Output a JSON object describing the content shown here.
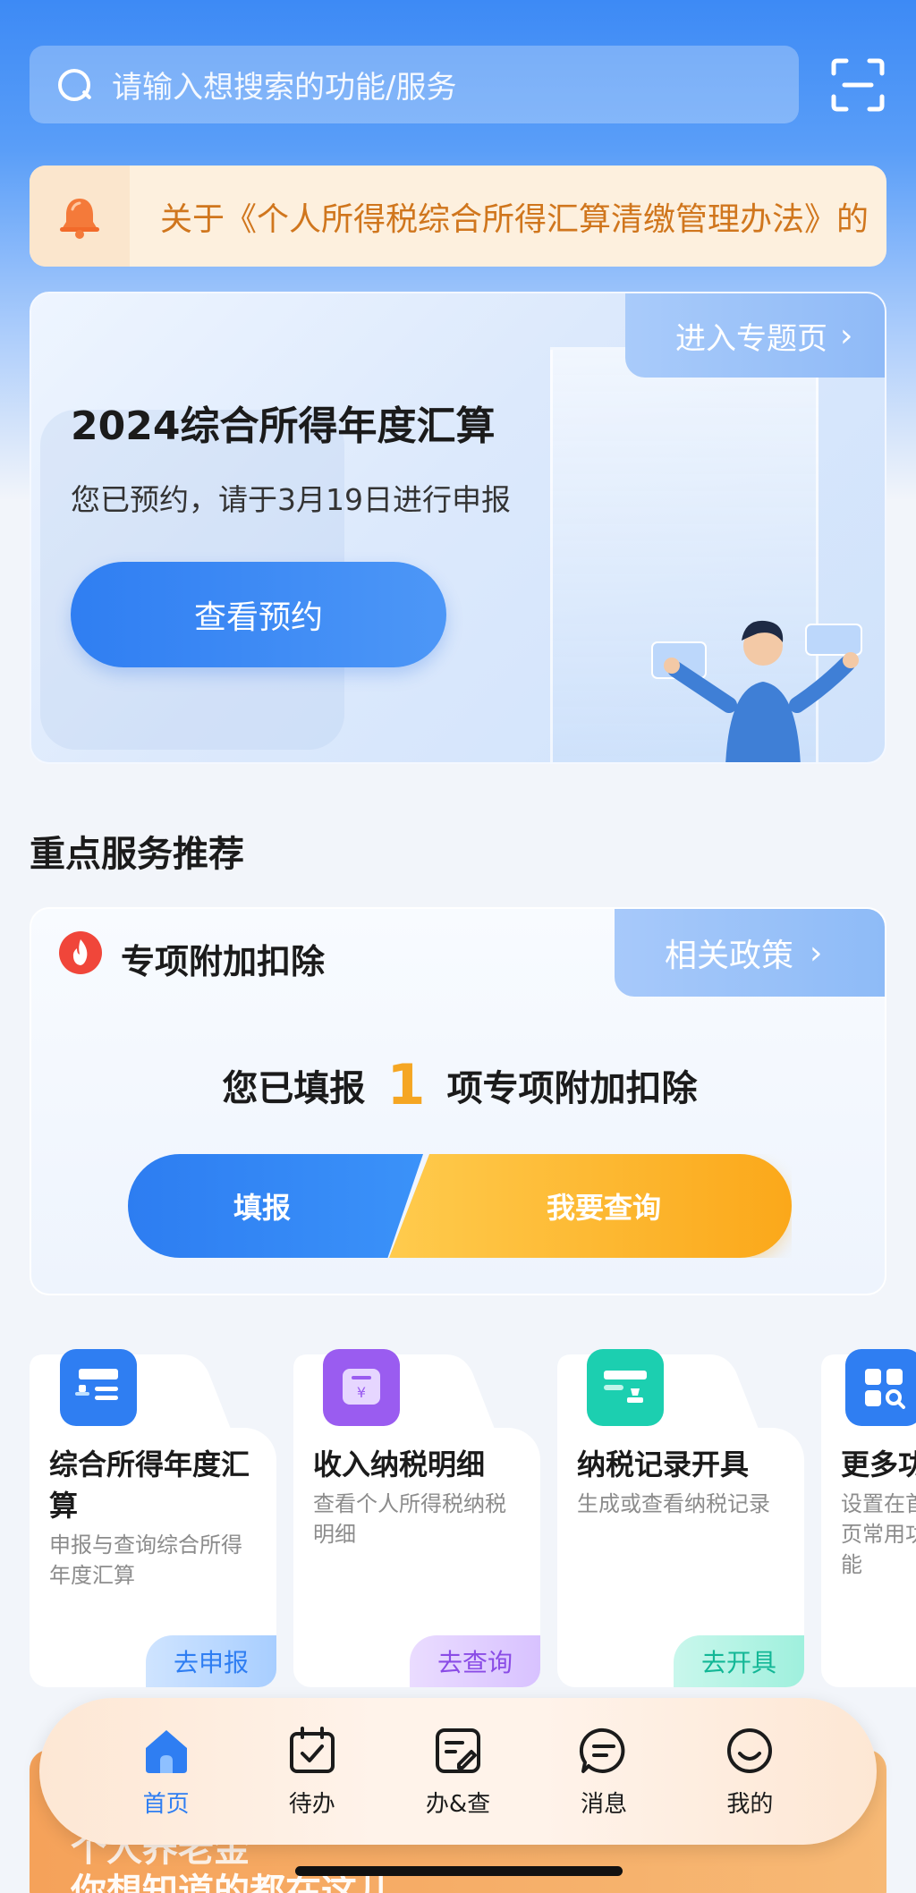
{
  "search": {
    "placeholder": "请输入想搜索的功能/服务"
  },
  "notice": {
    "text": "关于《个人所得税综合所得汇算清缴管理办法》的"
  },
  "hero": {
    "link_label": "进入专题页",
    "title": "2024综合所得年度汇算",
    "subtitle": "您已预约，请于3月19日进行申报",
    "button_label": "查看预约"
  },
  "section": {
    "title": "重点服务推荐"
  },
  "deduction": {
    "title": "专项附加扣除",
    "link_label": "相关政策",
    "status_prefix": "您已填报",
    "count": "1",
    "status_suffix": "项专项附加扣除",
    "fill_label": "填报",
    "query_label": "我要查询"
  },
  "services": [
    {
      "title": "综合所得年度汇算",
      "desc": "申报与查询综合所得年度汇算",
      "action": "去申报",
      "color": "#2f7ef2"
    },
    {
      "title": "收入纳税明细",
      "desc": "查看个人所得税纳税明细",
      "action": "去查询",
      "color": "#9a5cf0"
    },
    {
      "title": "纳税记录开具",
      "desc": "生成或查看纳税记录",
      "action": "去开具",
      "color": "#1ccfb0"
    },
    {
      "title": "更多功能",
      "desc": "设置在首页常用功能",
      "action": "",
      "color": "#2f7ef2"
    }
  ],
  "banner": {
    "line1": "个人养老金",
    "line2": "你想知道的都在这儿"
  },
  "nav": [
    {
      "label": "首页",
      "active": true
    },
    {
      "label": "待办"
    },
    {
      "label": "办&查"
    },
    {
      "label": "消息"
    },
    {
      "label": "我的"
    }
  ],
  "colors": {
    "accent": "#2f7ef2",
    "warning": "#f5a623",
    "notice_text": "#d0761d"
  }
}
